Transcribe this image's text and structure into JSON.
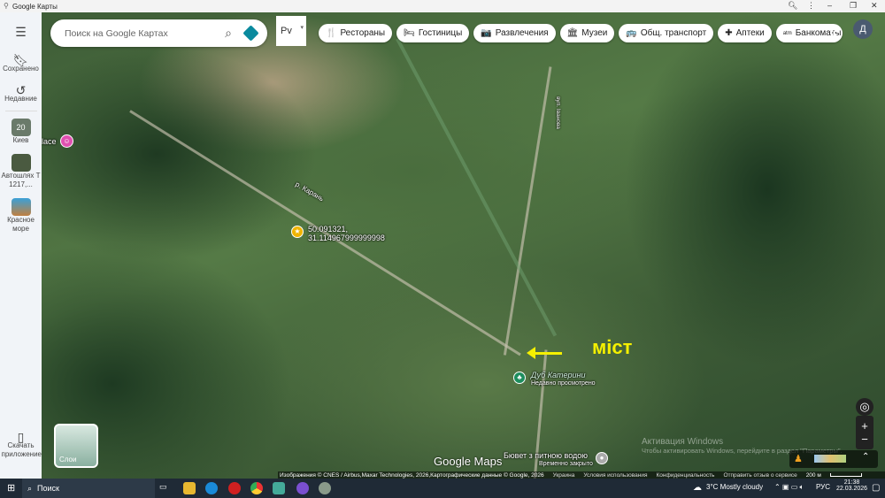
{
  "window": {
    "title": "Google Карты"
  },
  "sidebar": {
    "items": [
      {
        "label": "Сохранено"
      },
      {
        "label": "Недавние"
      },
      {
        "label": "Киев",
        "badge": "20"
      },
      {
        "label": "Автошлях Т 1217,..."
      },
      {
        "label": "Красное море"
      }
    ],
    "bottom_label": "Скачать приложение"
  },
  "search": {
    "placeholder": "Поиск на Google Картах"
  },
  "language": {
    "value": "Рv"
  },
  "chips": [
    {
      "icon": "🍴",
      "label": "Рестораны"
    },
    {
      "icon": "🛏",
      "label": "Гостиницы"
    },
    {
      "icon": "📷",
      "label": "Развлечения"
    },
    {
      "icon": "🏛",
      "label": "Музеи"
    },
    {
      "icon": "🚌",
      "label": "Общ. транспорт"
    },
    {
      "icon": "✚",
      "label": "Аптеки"
    },
    {
      "icon": "atm",
      "label": "Банкоматы"
    }
  ],
  "avatar": "Д",
  "map": {
    "coord_line1": "50.091321,",
    "coord_line2": "31.114967999999998",
    "river": "р. Карань",
    "street": "вул. Іванова",
    "place_left": "lace",
    "annotation": "міст",
    "poi1": {
      "name": "Дуб Катерини",
      "sub": "Недавно просмотрено"
    },
    "poi2": {
      "name": "Бювет з питною водою",
      "sub": "Временно закрыто"
    },
    "logo": "Google Maps",
    "layers_label": "Слои",
    "watermark1": "Активация Windows",
    "watermark2": "Чтобы активировать Windows, перейдите в раздел \"Параметры\".",
    "footer": [
      "Изображения © CNES / Airbus,Maxar Technologies, 2026,Картографические данные © Google, 2026",
      "Украина",
      "Условия использования",
      "Конфиденциальность",
      "Отправить отзыв о сервисе"
    ],
    "scale": "200 м"
  },
  "taskbar": {
    "search": "Поиск",
    "weather": "3°C  Mostly cloudy",
    "lang": "РУС",
    "time": "21:38",
    "date": "22.03.2026"
  }
}
